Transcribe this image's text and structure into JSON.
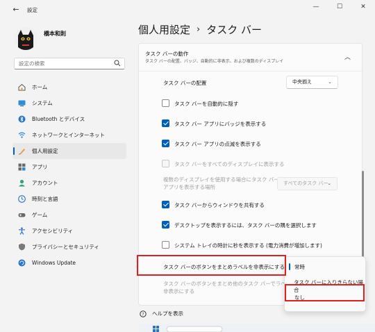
{
  "window": {
    "app_title": "設定",
    "minimize": "—",
    "maximize": "☐",
    "close": "✕"
  },
  "user": {
    "name": "橋本和則"
  },
  "search": {
    "placeholder": "設定の検索"
  },
  "sidebar": {
    "items": [
      {
        "label": "ホーム",
        "icon": "home-icon"
      },
      {
        "label": "システム",
        "icon": "system-icon"
      },
      {
        "label": "Bluetooth とデバイス",
        "icon": "bluetooth-icon"
      },
      {
        "label": "ネットワークとインターネット",
        "icon": "network-icon"
      },
      {
        "label": "個人用設定",
        "icon": "personalization-icon"
      },
      {
        "label": "アプリ",
        "icon": "apps-icon"
      },
      {
        "label": "アカウント",
        "icon": "account-icon"
      },
      {
        "label": "時刻と言語",
        "icon": "time-language-icon"
      },
      {
        "label": "ゲーム",
        "icon": "gaming-icon"
      },
      {
        "label": "アクセシビリティ",
        "icon": "accessibility-icon"
      },
      {
        "label": "プライバシーとセキュリティ",
        "icon": "privacy-icon"
      },
      {
        "label": "Windows Update",
        "icon": "windows-update-icon"
      }
    ],
    "active_index": 4
  },
  "breadcrumb": {
    "parent": "個人用設定",
    "separator": "›",
    "current": "タスク バー"
  },
  "section": {
    "title": "タスク バーの動作",
    "subtitle": "タスク バーの配置、バッジ、自動的に非表示、および複数のディスプレイ"
  },
  "settings": {
    "alignment_label": "タスク バーの配置",
    "alignment_value": "中央揃え",
    "auto_hide": "タスク バーを自動的に隠す",
    "badges": "タスク バー アプリにバッジを表示する",
    "flashing": "タスク バー アプリの点滅を表示する",
    "all_displays": "タスク バーをすべてのディスプレイに表示する",
    "multi_display_label_1": "複数のディスプレイを使用する場合にタスク バー",
    "multi_display_label_2": "アプリを表示する場所",
    "multi_display_value": "すべてのタスク バー",
    "share_window": "タスク バーからウィンドウを共有する",
    "desktop_corner": "デスクトップを表示するには、タスク バーの隅を選択します",
    "seconds_clock": "システム トレイの時計に秒を表示する (電力消費が増加します)",
    "combine_buttons": "タスク バーのボタンをまとめラベルを非表示にする",
    "combine_other_1": "タスク バーのボタンをまとめ他のタスク バーでラベルを",
    "combine_other_2": "非表示にする"
  },
  "checkbox_states": {
    "auto_hide": false,
    "badges": true,
    "flashing": true,
    "all_displays": false,
    "share_window": true,
    "desktop_corner": true,
    "seconds_clock": false
  },
  "popup": {
    "options": [
      "常時",
      "タスク バーに入りきらない場合",
      "なし"
    ],
    "selected_index": 0
  },
  "help": {
    "label": "ヘルプを表示"
  },
  "colors": {
    "accent": "#005fb8",
    "highlight_box": "#e02020"
  }
}
